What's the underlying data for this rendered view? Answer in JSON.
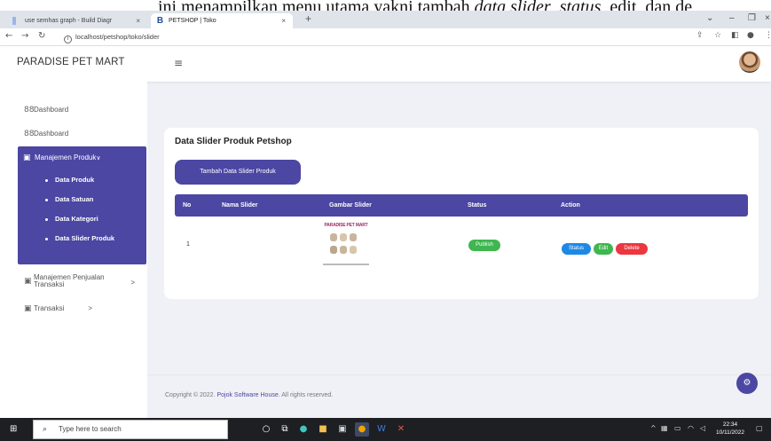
{
  "caption": {
    "prefix": "ini menampilkan menu utama yakni tambah ",
    "italic1": "data slider",
    "mid": ", ",
    "italic2": "status",
    "suffix": ", edit, dan de"
  },
  "browser": {
    "tabs": [
      {
        "title": "use semhas graph - Build Diagr",
        "close": "×"
      },
      {
        "title": "PETSHOP | Toko",
        "favicon": "B",
        "close": "×"
      }
    ],
    "new_tab": "+",
    "url": "localhost/petshop/toko/slider"
  },
  "app": {
    "brand": "PARADISE PET MART",
    "sidebar": {
      "items": [
        {
          "label": "Dashboard",
          "icon": "grid-icon"
        },
        {
          "label": "Dashboard",
          "icon": "grid-icon"
        }
      ],
      "active_group": {
        "label": "Manajemen Produk",
        "chevron": "∨",
        "children": [
          "Data Produk",
          "Data Satuan",
          "Data Kategori",
          "Data Slider Produk"
        ]
      },
      "groups": [
        {
          "label": "Manajemen Penjualan Transaksi",
          "label_line1": "Manajemen Penjualan",
          "label_line2": "Transaksi",
          "chevron": ">"
        },
        {
          "label": "Transaksi",
          "chevron": ">"
        }
      ]
    },
    "card": {
      "title": "Data Slider Produk Petshop",
      "add_button": "Tambah Data Slider Produk",
      "columns": [
        "No",
        "Nama Slider",
        "Gambar Slider",
        "Status",
        "Action"
      ],
      "rows": [
        {
          "no": "1",
          "nama": "",
          "gambar_title": "PARADISE PET MART",
          "status": "Publish",
          "actions": [
            "Status",
            "Edit",
            "Delete"
          ]
        }
      ]
    },
    "footer": {
      "prefix": "Copyright © 2022. ",
      "link": "Pojok Software House",
      "suffix": ". All rights reserved."
    }
  },
  "taskbar": {
    "search_placeholder": "Type here to search",
    "time": "22:34",
    "date": "10/11/2022"
  },
  "colors": {
    "primary": "#4b47a3",
    "success": "#3fb650",
    "info": "#1e88e5",
    "danger": "#ea3740"
  }
}
